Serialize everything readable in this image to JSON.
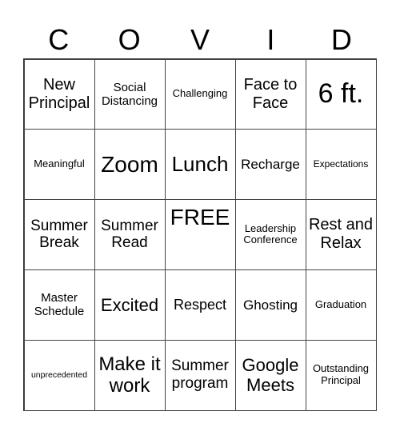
{
  "header": {
    "letters": [
      "C",
      "O",
      "V",
      "I",
      "D"
    ]
  },
  "board": {
    "rows": [
      [
        "New Principal",
        "Social Distancing",
        "Challenging",
        "Face to Face",
        "6 ft."
      ],
      [
        "Meaningful",
        "Zoom",
        "Lunch",
        "Recharge",
        "Expectations"
      ],
      [
        "Summer Break",
        "Summer Read",
        "FREE",
        "Leadership Conference",
        "Rest and Relax"
      ],
      [
        "Master Schedule",
        "Excited",
        "Respect",
        "Ghosting",
        "Graduation"
      ],
      [
        "unprecedented",
        "Make it work",
        "Summer program",
        "Google Meets",
        "Outstanding Principal"
      ]
    ]
  }
}
